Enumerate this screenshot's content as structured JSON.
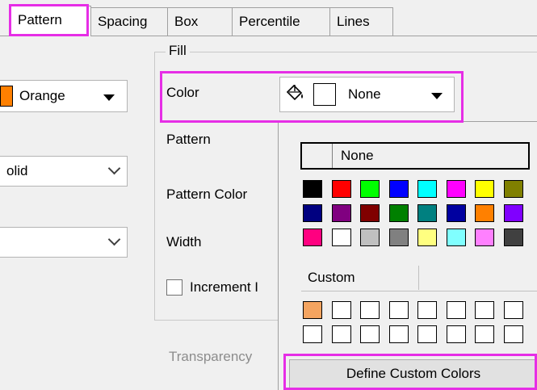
{
  "tabs": [
    "Pattern",
    "Spacing",
    "Box",
    "Percentile",
    "Lines"
  ],
  "fill_group": {
    "title": "Fill"
  },
  "left": {
    "color_combo_value": "Orange",
    "color_swatch": "#ff8000",
    "style_combo_value": "olid",
    "third_combo_value": ""
  },
  "fill": {
    "color_label": "Color",
    "color_value": "None",
    "pattern_label": "Pattern",
    "pattern_color_label": "Pattern Color",
    "width_label": "Width",
    "increment_label": "Increment I",
    "transparency_label": "Transparency"
  },
  "dropdown": {
    "none_label": "None",
    "custom_tab": "Custom",
    "define_button": "Define Custom Colors",
    "standard_colors": [
      [
        "#000000",
        "#ff0000",
        "#00ff00",
        "#0000ff",
        "#00ffff",
        "#ff00ff",
        "#ffff00",
        "#808000"
      ],
      [
        "#000080",
        "#800080",
        "#800000",
        "#008000",
        "#008080",
        "#0000a0",
        "#ff8000",
        "#8000ff"
      ],
      [
        "#ff0080",
        "#ffffff",
        "#c0c0c0",
        "#808080",
        "#ffff80",
        "#80ffff",
        "#ff80ff",
        "#404040"
      ]
    ],
    "custom_colors": [
      [
        "#f4a460",
        "",
        "",
        "",
        "",
        "",
        "",
        ""
      ],
      [
        "",
        "",
        "",
        "",
        "",
        "",
        "",
        ""
      ]
    ]
  },
  "highlight_color": "#e62ee6"
}
